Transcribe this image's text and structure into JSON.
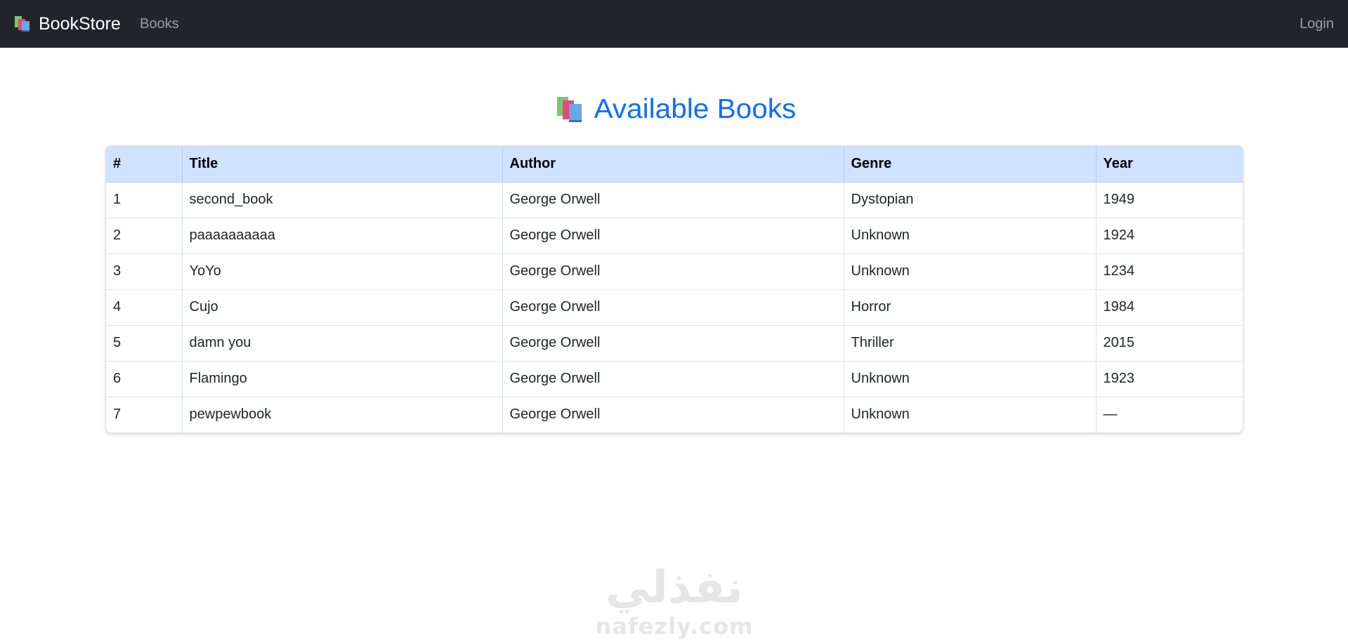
{
  "navbar": {
    "brand_icon": "books-icon",
    "brand": "BookStore",
    "links": {
      "books": "Books",
      "login": "Login"
    }
  },
  "page": {
    "heading_icon": "books-icon",
    "heading": "Available Books"
  },
  "table": {
    "headers": [
      "#",
      "Title",
      "Author",
      "Genre",
      "Year"
    ],
    "rows": [
      [
        "1",
        "second_book",
        "George Orwell",
        "Dystopian",
        "1949"
      ],
      [
        "2",
        "paaaaaaaaaa",
        "George Orwell",
        "Unknown",
        "1924"
      ],
      [
        "3",
        "YoYo",
        "George Orwell",
        "Unknown",
        "1234"
      ],
      [
        "4",
        "Cujo",
        "George Orwell",
        "Horror",
        "1984"
      ],
      [
        "5",
        "damn you",
        "George Orwell",
        "Thriller",
        "2015"
      ],
      [
        "6",
        "Flamingo",
        "George Orwell",
        "Unknown",
        "1923"
      ],
      [
        "7",
        "pewpewbook",
        "George Orwell",
        "Unknown",
        "—"
      ]
    ]
  },
  "watermark": {
    "arabic": "نفذلي",
    "latin": "nafezly.com"
  },
  "colors": {
    "navbar_bg": "#212529",
    "accent": "#0d6efd",
    "table_header_bg": "#cfe2ff"
  }
}
